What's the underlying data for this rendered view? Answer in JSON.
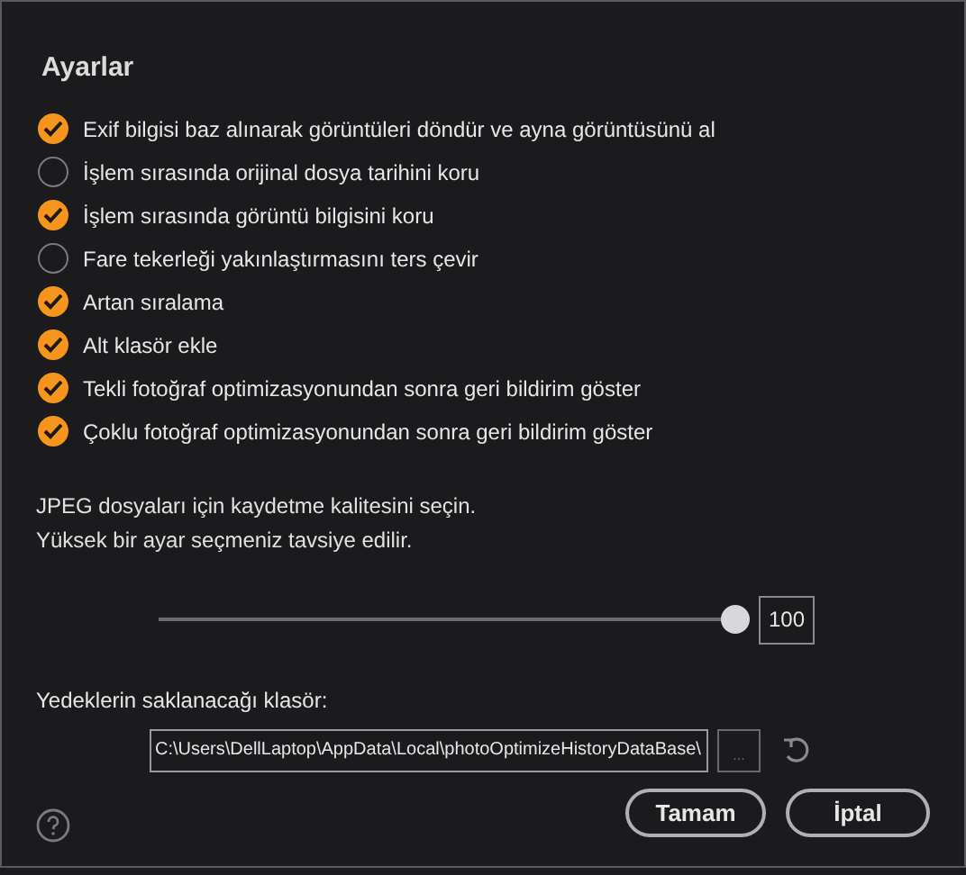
{
  "title": "Ayarlar",
  "options": [
    {
      "label": "Exif bilgisi baz alınarak görüntüleri döndür ve ayna görüntüsünü al",
      "checked": true
    },
    {
      "label": "İşlem sırasında orijinal dosya tarihini koru",
      "checked": false
    },
    {
      "label": "İşlem sırasında görüntü bilgisini koru",
      "checked": true
    },
    {
      "label": "Fare tekerleği yakınlaştırmasını ters çevir",
      "checked": false
    },
    {
      "label": "Artan sıralama",
      "checked": true
    },
    {
      "label": "Alt klasör ekle",
      "checked": true
    },
    {
      "label": "Tekli fotoğraf optimizasyonundan sonra geri bildirim göster",
      "checked": true
    },
    {
      "label": "Çoklu fotoğraf optimizasyonundan sonra geri bildirim göster",
      "checked": true
    }
  ],
  "quality": {
    "description": [
      "JPEG dosyaları için kaydetme kalitesini seçin.",
      "Yüksek bir ayar seçmeniz tavsiye edilir."
    ],
    "level": 1,
    "value": "100"
  },
  "backup": {
    "label": "Yedeklerin saklanacağı klasör:",
    "path": "C:\\Users\\DellLaptop\\AppData\\Local\\photoOptimizeHistoryDataBase\\",
    "browse": "..."
  },
  "buttons": [
    "Tamam",
    "İptal"
  ]
}
